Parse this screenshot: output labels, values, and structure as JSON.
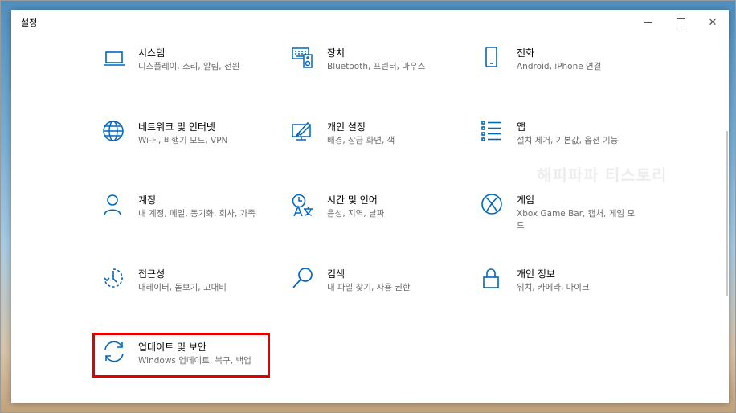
{
  "window": {
    "title": "설정"
  },
  "watermark": "해피파파 티스토리",
  "tiles": [
    {
      "name": "시스템",
      "desc": "디스플레이, 소리, 알림, 전원",
      "icon": "monitor-icon"
    },
    {
      "name": "장치",
      "desc": "Bluetooth, 프린터, 마우스",
      "icon": "devices-icon"
    },
    {
      "name": "전화",
      "desc": "Android, iPhone 연결",
      "icon": "phone-icon"
    },
    {
      "name": "네트워크 및 인터넷",
      "desc": "Wi-Fi, 비행기 모드, VPN",
      "icon": "globe-icon"
    },
    {
      "name": "개인 설정",
      "desc": "배경, 잠금 화면, 색",
      "icon": "paint-icon"
    },
    {
      "name": "앱",
      "desc": "설치 제거, 기본값, 옵션 기능",
      "icon": "apps-list-icon"
    },
    {
      "name": "계정",
      "desc": "내 계정, 메일, 동기화, 회사, 가족",
      "icon": "person-icon"
    },
    {
      "name": "시간 및 언어",
      "desc": "음성, 지역, 날짜",
      "icon": "time-language-icon"
    },
    {
      "name": "게임",
      "desc": "Xbox Game Bar, 캡처, 게임 모드",
      "icon": "xbox-icon"
    },
    {
      "name": "접근성",
      "desc": "내레이터, 돋보기, 고대비",
      "icon": "accessibility-icon"
    },
    {
      "name": "검색",
      "desc": "내 파일 찾기, 사용 권한",
      "icon": "search-icon"
    },
    {
      "name": "개인 정보",
      "desc": "위치, 카메라, 마이크",
      "icon": "lock-icon"
    },
    {
      "name": "업데이트 및 보안",
      "desc": "Windows 업데이트, 복구, 백업",
      "icon": "update-icon"
    }
  ],
  "colors": {
    "accent": "#0067c0",
    "highlight": "#e00000"
  }
}
